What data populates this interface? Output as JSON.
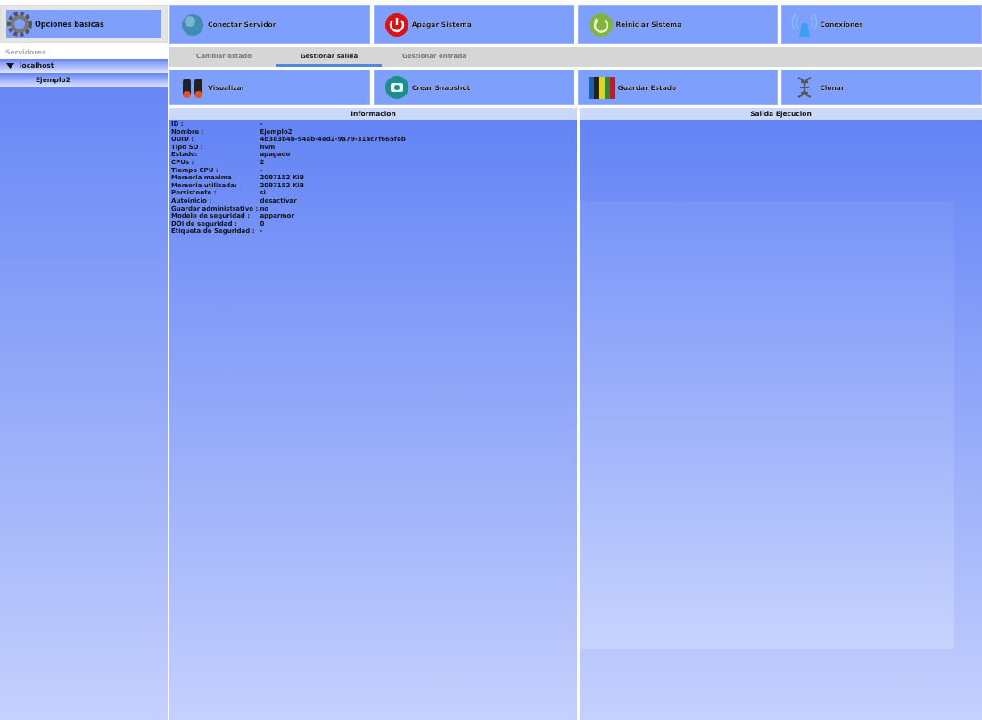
{
  "sidebar": {
    "options_button": "Opciones basicas",
    "section_label": "Servidores",
    "tree": [
      {
        "label": "localhost",
        "expanded": true,
        "children": [
          {
            "label": "Ejemplo2"
          }
        ]
      }
    ]
  },
  "toolbar": [
    {
      "label": "Conectar Servidor"
    },
    {
      "label": "Apagar Sistema"
    },
    {
      "label": "Reiniciar Sistema"
    },
    {
      "label": "Conexiones"
    }
  ],
  "tabs": [
    {
      "label": "Cambiar estado",
      "selected": false
    },
    {
      "label": "Gestionar salida",
      "selected": true
    },
    {
      "label": "Gestionar entrada",
      "selected": false
    }
  ],
  "actions": [
    {
      "label": "Visualizar"
    },
    {
      "label": "Crear Snapshot"
    },
    {
      "label": "Guardar Estado"
    },
    {
      "label": "Clonar"
    }
  ],
  "info_panel": {
    "title": "Informacion",
    "rows": [
      {
        "label": "ID :",
        "value": "-"
      },
      {
        "label": "Nombre :",
        "value": "Ejemplo2"
      },
      {
        "label": "UUID :",
        "value": "4b383b4b-94ab-4ed2-9a79-31ac7f665feb"
      },
      {
        "label": "Tipo SO :",
        "value": "hvm"
      },
      {
        "label": "Estado:",
        "value": "apagado"
      },
      {
        "label": "CPUs :",
        "value": "2"
      },
      {
        "label": "Tiempo CPU :",
        "value": "-"
      },
      {
        "label": "Memoria maxima",
        "value": "2097152 KiB"
      },
      {
        "label": "Memoria utilizada:",
        "value": "2097152 KiB"
      },
      {
        "label": "Persistente :",
        "value": "si"
      },
      {
        "label": "Autoinicio :",
        "value": "desactivar"
      },
      {
        "label": "Guardar administrativo :",
        "value": "no"
      },
      {
        "label": "Modelo de seguridad :",
        "value": "apparmor"
      },
      {
        "label": "DOI de seguridad :",
        "value": "0"
      },
      {
        "label": "Etiqueta de Seguridad :",
        "value": "-"
      }
    ]
  },
  "output_panel": {
    "title": "Salida Ejecucion"
  }
}
